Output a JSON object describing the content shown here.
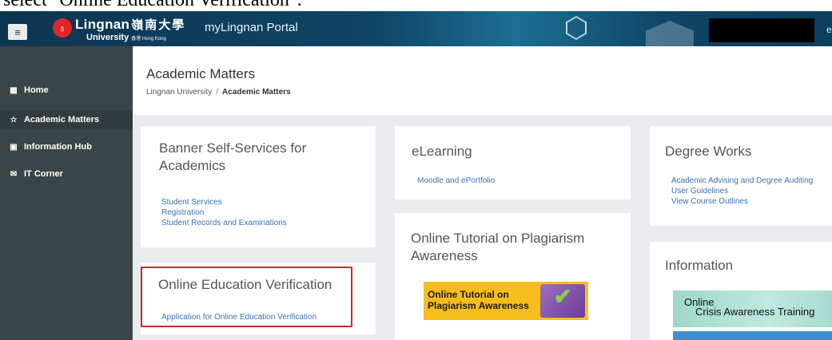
{
  "caption": {
    "text": "select \"Online Education Verification\"."
  },
  "topbar": {
    "menu_icon": "≡",
    "logo_mark": "♁",
    "logo_name": "Lingnan",
    "logo_chinese": "嶺南大學",
    "logo_university": "University",
    "logo_hk": "香港 Hong Kong",
    "portal_title": "myLingnan Portal",
    "user_initial": "e"
  },
  "sidebar": {
    "items": [
      {
        "label": "Home",
        "icon": "▦"
      },
      {
        "label": "Academic Matters",
        "icon": "☆"
      },
      {
        "label": "Information Hub",
        "icon": "▣"
      },
      {
        "label": "IT Corner",
        "icon": "✉"
      }
    ]
  },
  "header": {
    "title": "Academic Matters",
    "breadcrumb_root": "Lingnan University",
    "breadcrumb_sep": "/",
    "breadcrumb_current": "Academic Matters"
  },
  "cards": {
    "banner": {
      "title_line1": "Banner Self-Services for",
      "title_line2": "Academics",
      "links": [
        "Student Services",
        "Registration",
        "Student Records and Examinations"
      ]
    },
    "online_edu": {
      "title": "Online Education Verification",
      "links": [
        "Application for Online Education Verification"
      ]
    },
    "elearning": {
      "title": "eLearning",
      "links": [
        "Moodle and ePortfolio"
      ]
    },
    "plagiarism": {
      "title_line1": "Online Tutorial on Plagiarism",
      "title_line2": "Awareness",
      "banner_line1": "Online Tutorial on",
      "banner_line2": "Plagiarism Awareness"
    },
    "degree_works": {
      "title": "Degree Works",
      "links": [
        "Academic Advising and Degree Auditing",
        "User Guidelines",
        "View Course Outlines"
      ]
    },
    "information": {
      "title": "Information",
      "banner_line1": "Online",
      "banner_line2": "Crisis Awareness Training"
    }
  },
  "colors": {
    "topbar": "#0f4466",
    "sidebar": "#3b4548",
    "link": "#3a73b0",
    "highlight": "#d0262e",
    "plagiarism_banner": "#f7bd1c"
  }
}
